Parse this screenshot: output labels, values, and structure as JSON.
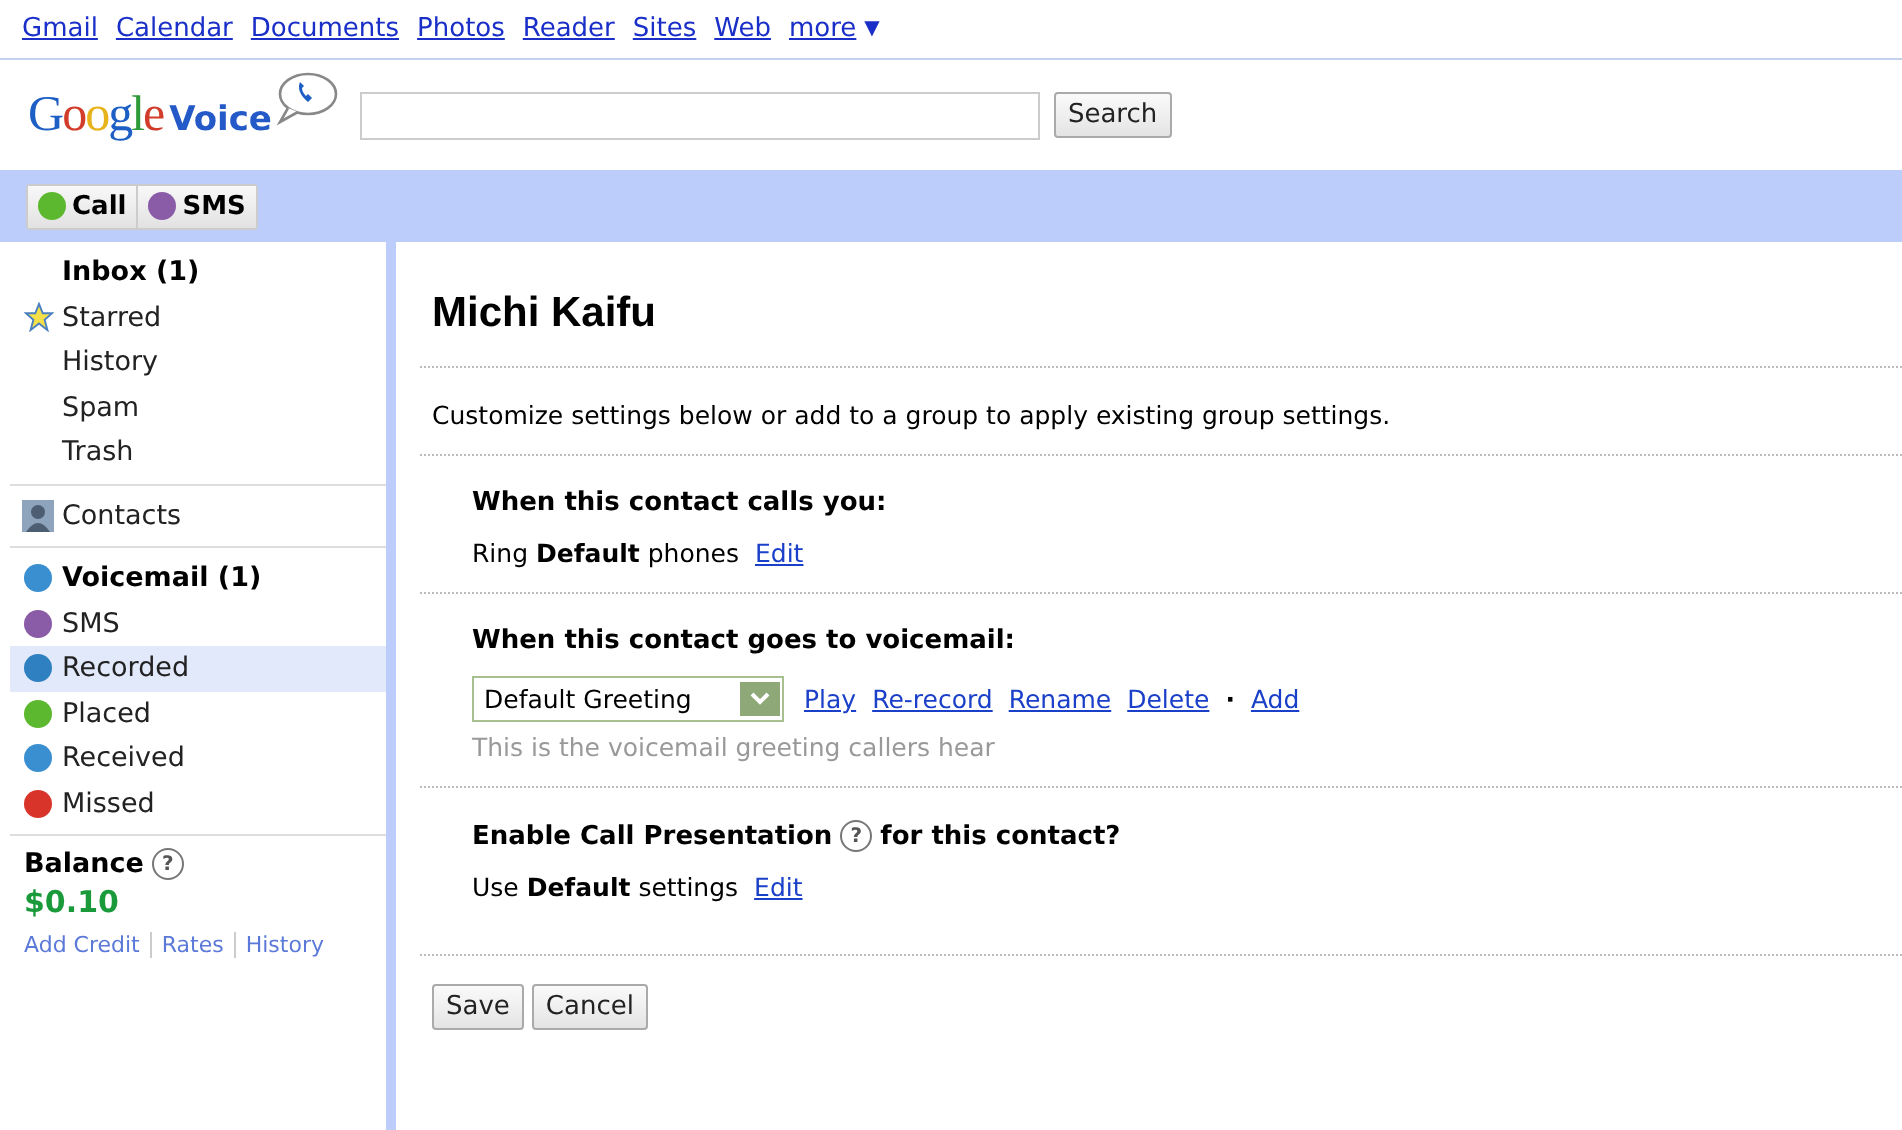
{
  "top_links": [
    "Gmail",
    "Calendar",
    "Documents",
    "Photos",
    "Reader",
    "Sites",
    "Web",
    "more"
  ],
  "more_caret": "▼",
  "logo": {
    "word1": "Google",
    "word2": "Voice"
  },
  "search": {
    "button": "Search"
  },
  "action_buttons": [
    {
      "label": "Call",
      "color": "#5cb82e"
    },
    {
      "label": "SMS",
      "color": "#8a5ca8"
    }
  ],
  "sidebar": {
    "groups": [
      [
        {
          "label": "Inbox (1)",
          "kind": "plain",
          "bold": true,
          "selected": false
        },
        {
          "label": "Starred",
          "kind": "star",
          "bold": false,
          "selected": false
        },
        {
          "label": "History",
          "kind": "plain",
          "bold": false,
          "selected": false
        },
        {
          "label": "Spam",
          "kind": "plain",
          "bold": false,
          "selected": false
        },
        {
          "label": "Trash",
          "kind": "plain",
          "bold": false,
          "selected": false
        }
      ],
      [
        {
          "label": "Contacts",
          "kind": "person",
          "bold": false,
          "selected": false
        }
      ],
      [
        {
          "label": "Voicemail (1)",
          "kind": "dot",
          "color": "#3a8fd0",
          "bold": true,
          "selected": false
        },
        {
          "label": "SMS",
          "kind": "dot",
          "color": "#8a5ca8",
          "bold": false,
          "selected": false
        },
        {
          "label": "Recorded",
          "kind": "dot",
          "color": "#2f80c0",
          "bold": false,
          "selected": true
        },
        {
          "label": "Placed",
          "kind": "dot",
          "color": "#5cb82e",
          "bold": false,
          "selected": false
        },
        {
          "label": "Received",
          "kind": "dot",
          "color": "#3a8fd0",
          "bold": false,
          "selected": false
        },
        {
          "label": "Missed",
          "kind": "dot",
          "color": "#d8342a",
          "bold": false,
          "selected": false
        }
      ]
    ],
    "balance": {
      "label": "Balance",
      "help": "?",
      "amount": "$0.10",
      "links": [
        "Add Credit",
        "Rates",
        "History"
      ]
    }
  },
  "main": {
    "title": "Michi Kaifu",
    "intro": "Customize settings below or add to a group to apply existing group settings.",
    "calls": {
      "heading": "When this contact calls you:",
      "text": "Ring **Default** phones",
      "link": "Edit"
    },
    "voicemail": {
      "heading": "When this contact goes to voicemail:",
      "greeting": "Default Greeting",
      "links": [
        "Play",
        "Re-record",
        "Rename",
        "Delete"
      ],
      "separator": "·",
      "add": "Add",
      "hint": "This is the voicemail greeting callers hear"
    },
    "presentation": {
      "heading_before": "Enable Call Presentation",
      "help": "?",
      "heading_after": "for this contact?",
      "text": "Use **Default** settings",
      "link": "Edit"
    },
    "buttons": [
      "Save",
      "Cancel"
    ]
  }
}
